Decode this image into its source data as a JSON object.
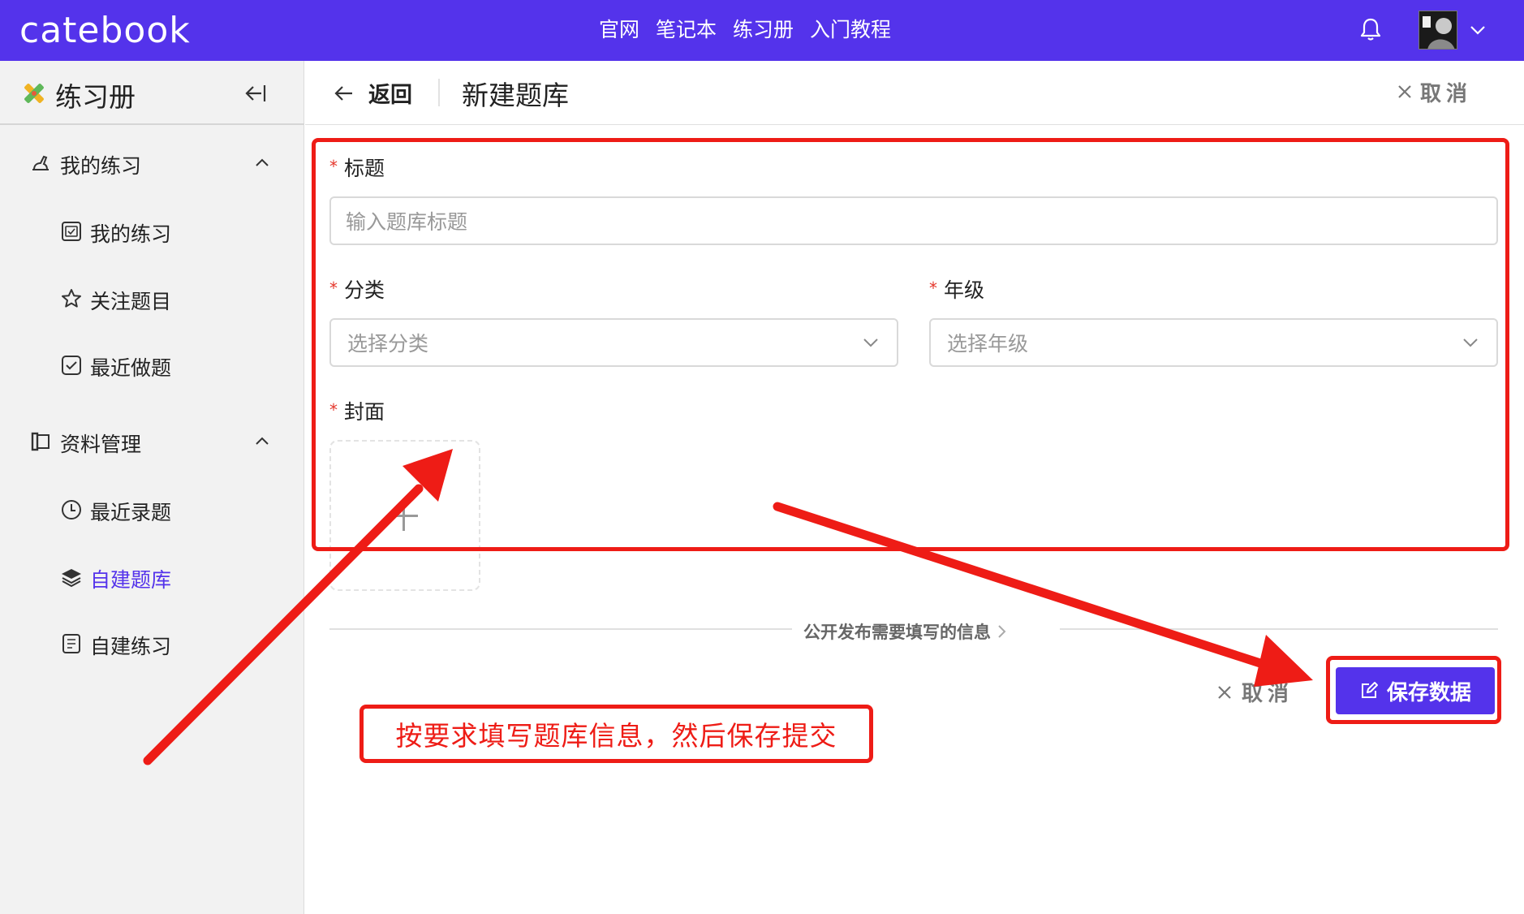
{
  "header": {
    "brand": "catebook",
    "nav": [
      "官网",
      "笔记本",
      "练习册",
      "入门教程"
    ]
  },
  "sidebar": {
    "title": "练习册",
    "groups": [
      {
        "label": "我的练习",
        "items": [
          "我的练习",
          "关注题目",
          "最近做题"
        ]
      },
      {
        "label": "资料管理",
        "items": [
          "最近录题",
          "自建题库",
          "自建练习"
        ]
      }
    ],
    "active_item": "自建题库"
  },
  "page": {
    "back_label": "返回",
    "title": "新建题库",
    "cancel_label": "取消"
  },
  "form": {
    "required_mark": "*",
    "title_label": "标题",
    "title_placeholder": "输入题库标题",
    "category_label": "分类",
    "category_placeholder": "选择分类",
    "grade_label": "年级",
    "grade_placeholder": "选择年级",
    "cover_label": "封面",
    "public_info_link": "公开发布需要填写的信息",
    "cancel_label": "取消",
    "save_label": "保存数据"
  },
  "annotation": {
    "callout_text": "按要求填写题库信息，然后保存提交",
    "color": "#ee1c16"
  },
  "colors": {
    "brand": "#5433eb",
    "required": "#e5372c"
  }
}
